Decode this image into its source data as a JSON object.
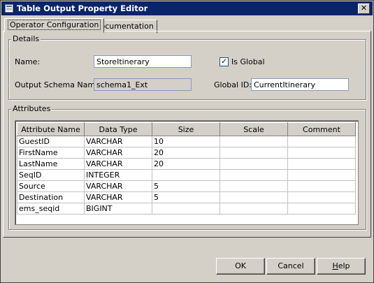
{
  "window": {
    "title": "Table Output Property Editor"
  },
  "tabs": [
    {
      "label": "Operator Configuration"
    },
    {
      "label": "Documentation"
    }
  ],
  "details": {
    "group_label": "Details",
    "name_label": "Name:",
    "name_value": "StoreItinerary",
    "is_global_label": "Is Global",
    "is_global_checked": true,
    "is_global_mark": "✓",
    "schema_label": "Output Schema Name:",
    "schema_value": "schema1_Ext",
    "global_id_label": "Global ID:",
    "global_id_value": "CurrentItinerary"
  },
  "attributes": {
    "group_label": "Attributes",
    "columns": [
      "Attribute Name",
      "Data Type",
      "Size",
      "Scale",
      "Comment"
    ],
    "rows": [
      [
        "GuestID",
        "VARCHAR",
        "10",
        "",
        ""
      ],
      [
        "FirstName",
        "VARCHAR",
        "20",
        "",
        ""
      ],
      [
        "LastName",
        "VARCHAR",
        "20",
        "",
        ""
      ],
      [
        "SeqID",
        "INTEGER",
        "",
        "",
        ""
      ],
      [
        "Source",
        "VARCHAR",
        "5",
        "",
        ""
      ],
      [
        "Destination",
        "VARCHAR",
        "5",
        "",
        ""
      ],
      [
        "ems_seqid",
        "BIGINT",
        "",
        "",
        ""
      ]
    ]
  },
  "buttons": {
    "ok": "OK",
    "cancel": "Cancel",
    "help_u": "H",
    "help_rest": "elp"
  },
  "colors": {
    "titlebar": "#0a246a",
    "face": "#d4d0c8"
  }
}
